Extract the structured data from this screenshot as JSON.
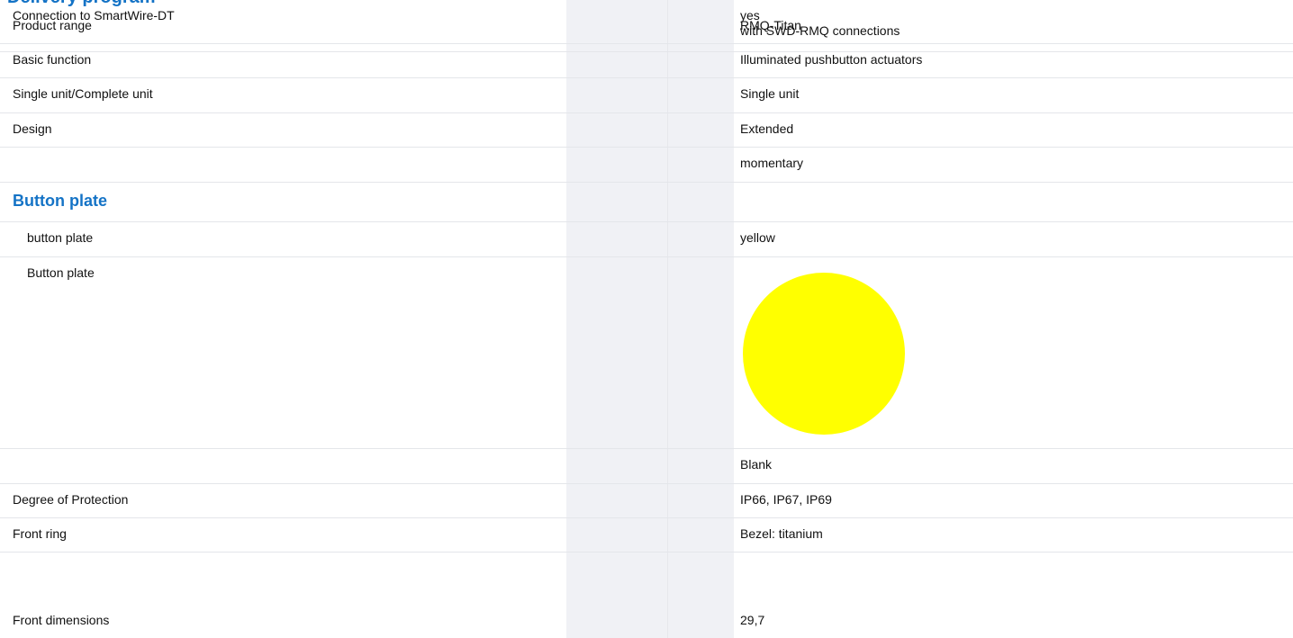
{
  "top_heading": "Delivery program",
  "rows": [
    {
      "label": "Product range",
      "value": "RMQ-Titan"
    },
    {
      "label": "Basic function",
      "value": "Illuminated pushbutton actuators"
    },
    {
      "label": "Single unit/Complete unit",
      "value": "Single unit"
    },
    {
      "label": "Design",
      "value": "Extended"
    },
    {
      "label": "",
      "value": "momentary"
    }
  ],
  "button_plate_section": {
    "heading": "Button plate",
    "rows": [
      {
        "label": "button plate",
        "value": "yellow"
      },
      {
        "label": "Button plate",
        "swatch_color": "#ffff00"
      },
      {
        "label": "",
        "value": "Blank"
      }
    ]
  },
  "lower_rows": [
    {
      "label": "Degree of Protection",
      "value": "IP66, IP67, IP69"
    },
    {
      "label": "Front ring",
      "value": "Bezel: titanium"
    },
    {
      "label": "Connection to SmartWire-DT",
      "value_line1": "yes",
      "value_line2": "with SWD-RMQ connections"
    },
    {
      "label": "Front dimensions",
      "value": "29,7"
    }
  ]
}
